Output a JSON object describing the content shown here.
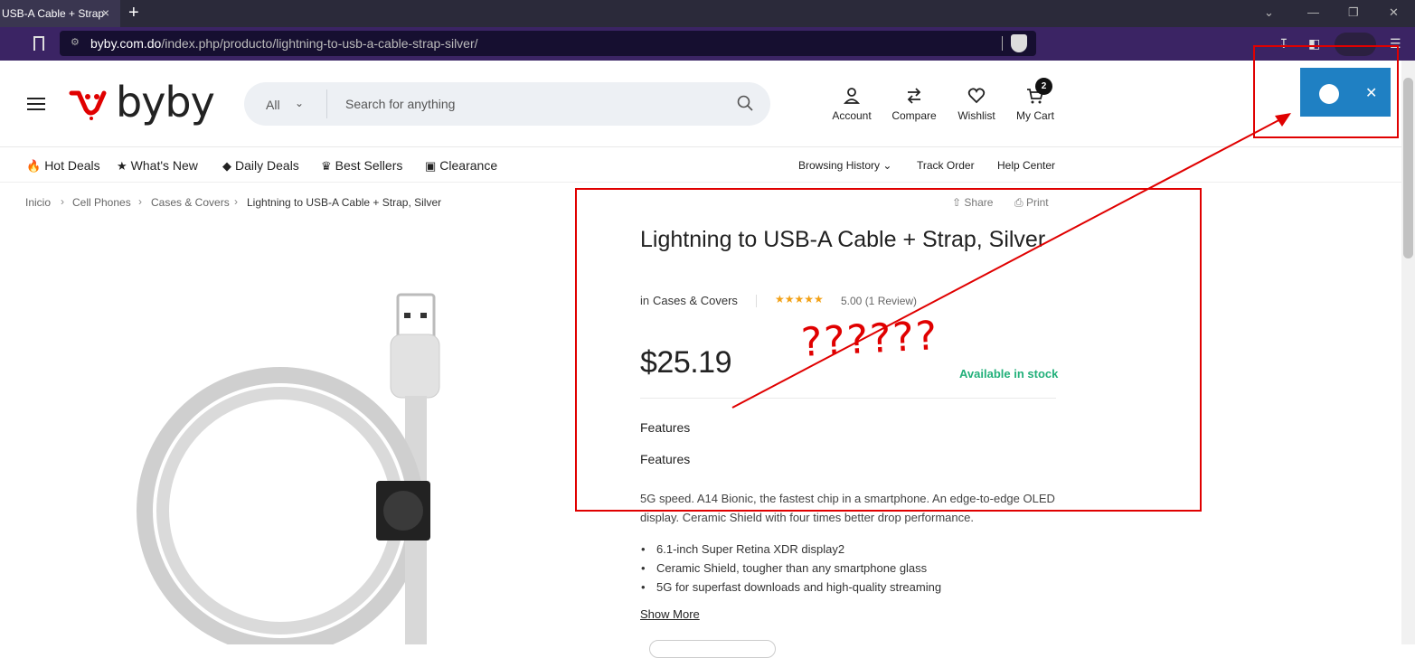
{
  "browser": {
    "tab_title": "USB-A Cable + Strap",
    "tab_close": "×",
    "new_tab": "+",
    "url_host": "byby.com.do",
    "url_path": "/index.php/producto/lightning-to-usb-a-cable-strap-silver/"
  },
  "site": {
    "logo_text": "byby",
    "search": {
      "category": "All",
      "placeholder": "Search for anything"
    },
    "header_links": [
      {
        "label": "Account",
        "icon": "user-icon"
      },
      {
        "label": "Compare",
        "icon": "compare-icon"
      },
      {
        "label": "Wishlist",
        "icon": "heart-icon"
      },
      {
        "label": "My Cart",
        "icon": "cart-icon"
      }
    ],
    "cart_count": "2",
    "nav": [
      {
        "label": "Hot Deals",
        "icon": "fire-icon"
      },
      {
        "label": "What's New",
        "icon": "star-icon"
      },
      {
        "label": "Daily Deals",
        "icon": "tag-icon"
      },
      {
        "label": "Best Sellers",
        "icon": "crown-icon"
      },
      {
        "label": "Clearance",
        "icon": "percent-icon"
      }
    ],
    "nav_right": [
      "Browsing History",
      "Track Order",
      "Help Center"
    ]
  },
  "breadcrumb": [
    "Inicio",
    "Cell Phones",
    "Cases & Covers",
    "Lightning to USB-A Cable + Strap, Silver"
  ],
  "actions": {
    "share": "Share",
    "print": "Print"
  },
  "product": {
    "title": "Lightning to USB-A Cable + Strap, Silver",
    "in_label": "in",
    "category": "Cases & Covers",
    "stars": "★★★★★",
    "rating_text": "5.00 (1 Review)",
    "price": "$25.19",
    "stock": "Available in stock",
    "features_heading_1": "Features",
    "features_heading_2": "Features",
    "description": "5G speed. A14 Bionic, the fastest chip in a smartphone. An edge-to-edge OLED display. Ceramic Shield with four times better drop performance.",
    "bullets": [
      "6.1-inch Super Retina XDR display2",
      "Ceramic Shield, tougher than any smartphone glass",
      "5G for superfast downloads and high-quality streaming"
    ],
    "show_more": "Show More"
  },
  "annotation": {
    "text": "??????",
    "color": "#e00000"
  },
  "colors": {
    "accent": "#e00000",
    "stock_green": "#22b07a",
    "widget_blue": "#1f80c3",
    "browser_purple": "#3b2464"
  }
}
